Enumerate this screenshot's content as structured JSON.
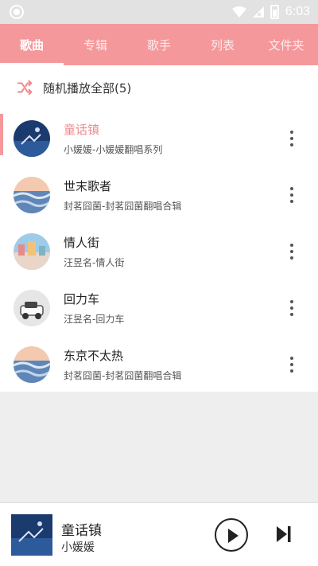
{
  "status_bar": {
    "time": "6:03"
  },
  "tabs": [
    {
      "label": "歌曲",
      "active": true
    },
    {
      "label": "专辑",
      "active": false
    },
    {
      "label": "歌手",
      "active": false
    },
    {
      "label": "列表",
      "active": false
    },
    {
      "label": "文件夹",
      "active": false
    }
  ],
  "shuffle": {
    "label": "随机播放全部(5)",
    "icon": "shuffle-icon"
  },
  "songs": [
    {
      "title": "童话镇",
      "subtitle": "小媛媛-小媛媛翻唱系列",
      "playing": true
    },
    {
      "title": "世末歌者",
      "subtitle": "封茗囧菌-封茗囧菌翻唱合辑",
      "playing": false
    },
    {
      "title": "情人街",
      "subtitle": "汪昱名-情人街",
      "playing": false
    },
    {
      "title": "回力车",
      "subtitle": "汪昱名-回力车",
      "playing": false
    },
    {
      "title": "东京不太热",
      "subtitle": "封茗囧菌-封茗囧菌翻唱合辑",
      "playing": false
    }
  ],
  "now_playing": {
    "title": "童话镇",
    "artist": "小媛媛"
  },
  "colors": {
    "accent": "#f4989b",
    "status_bar": "#e2e2e2",
    "playing_title": "#ef8a8c"
  }
}
